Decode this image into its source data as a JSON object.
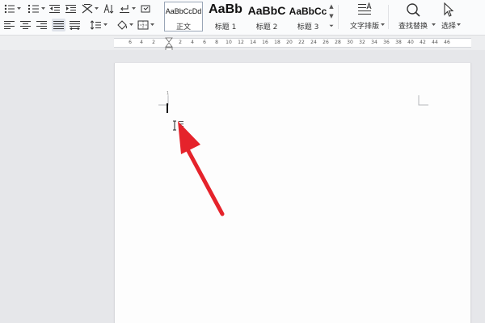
{
  "ribbon": {
    "styles": [
      {
        "preview": "AaBbCcDd",
        "name": "正文"
      },
      {
        "preview": "AaBb",
        "name": "标题 1"
      },
      {
        "preview": "AaBbC",
        "name": "标题 2"
      },
      {
        "preview": "AaBbCc",
        "name": "标题 3"
      }
    ],
    "text_layout_label": "文字排版",
    "find_replace_label": "查找替换",
    "select_label": "选择"
  },
  "ruler": {
    "ticks": [
      "6",
      "4",
      "2",
      "2",
      "4",
      "6",
      "8",
      "10",
      "12",
      "14",
      "16",
      "18",
      "20",
      "22",
      "24",
      "26",
      "28",
      "30",
      "32",
      "34",
      "36",
      "38",
      "40",
      "42",
      "44",
      "46"
    ]
  },
  "document": {
    "line_number": "1"
  },
  "colors": {
    "annotation_arrow": "#e5232b",
    "ribbon_bg": "#fafbfc",
    "canvas_bg": "#e6e7ea"
  },
  "icons": [
    "bullet-list-icon",
    "numbered-list-icon",
    "decrease-indent-icon",
    "increase-indent-icon",
    "text-direction-icon",
    "sort-icon",
    "line-break-icon",
    "show-marks-icon",
    "align-left-icon",
    "align-center-icon",
    "align-right-icon",
    "justify-icon",
    "distribute-icon",
    "line-spacing-icon",
    "shading-icon",
    "borders-icon",
    "text-layout-icon",
    "search-icon",
    "select-cursor-icon",
    "arrow-annotation-icon",
    "ibeam-cursor-icon"
  ]
}
